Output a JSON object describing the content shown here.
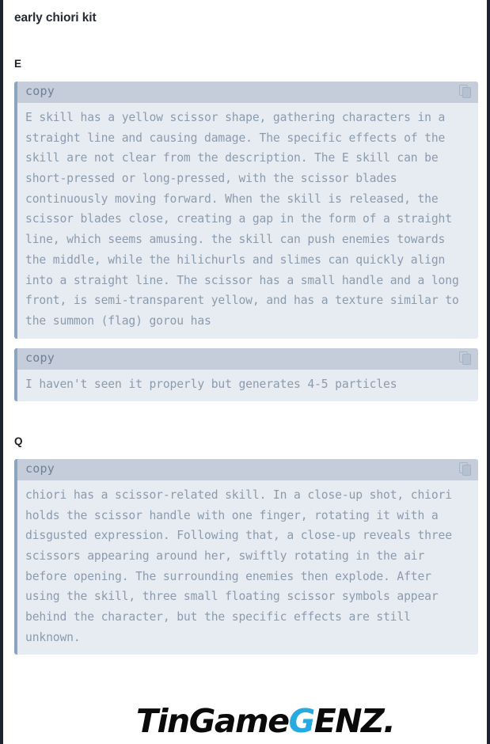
{
  "page": {
    "title": "early chiori kit"
  },
  "sections": [
    {
      "label": "E",
      "blocks": [
        {
          "header_label": "copy",
          "copy_icon": "copy-icon",
          "text": "E skill has a yellow scissor shape, gathering characters in a straight line and causing damage. The specific effects of the skill are not clear from the description. The E skill can be short-pressed or long-pressed, with the scissor blades continuously moving forward. When the skill is released, the scissor blades close, creating a gap in the form of a straight line, which seems amusing. the skill can push enemies towards the middle, while the hilichurls and slimes can quickly align into a straight line. The scissor has a small handle and a long front, is semi-transparent yellow, and has a texture similar to the summon (flag) gorou has"
        },
        {
          "header_label": "copy",
          "copy_icon": "copy-icon",
          "text": "I haven't seen it properly but generates 4-5 particles"
        }
      ]
    },
    {
      "label": "Q",
      "blocks": [
        {
          "header_label": "copy",
          "copy_icon": "copy-icon",
          "text": "chiori has a scissor-related skill. In a close-up shot, chiori holds the scissor handle with one finger, rotating it with a disgusted expression. Following that, a close-up reveals three scissors appearing around her, swiftly rotating in the air before opening. The surrounding enemies then explode. After using the skill, three small floating scissor symbols appear behind the character, but the specific effects are still unknown."
        }
      ]
    }
  ],
  "watermark": {
    "part1": "TinGame",
    "part2": "G",
    "part3": "ENZ."
  },
  "colors": {
    "page_border": "#1d2330",
    "code_header_bg": "#c4cdd9",
    "code_body_bg": "#e7ecf2",
    "code_accent": "#8ba4c0",
    "code_text": "#8b9bae",
    "title_text": "#252b33",
    "watermark_accent": "#27a9e1"
  }
}
